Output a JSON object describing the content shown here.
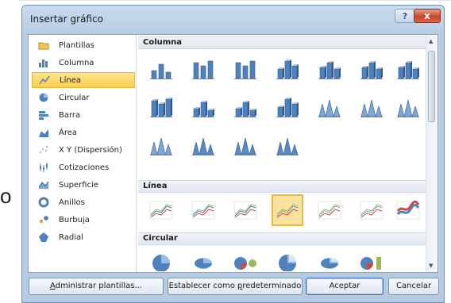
{
  "background_char": "o",
  "dialog": {
    "title": "Insertar gráfico",
    "help_label": "?",
    "close_label": "x"
  },
  "chart_types": [
    {
      "label": "Plantillas",
      "icon": "folder-icon",
      "selected": false
    },
    {
      "label": "Columna",
      "icon": "column-chart-icon",
      "selected": false
    },
    {
      "label": "Línea",
      "icon": "line-chart-icon",
      "selected": true
    },
    {
      "label": "Circular",
      "icon": "pie-chart-icon",
      "selected": false
    },
    {
      "label": "Barra",
      "icon": "bar-chart-icon",
      "selected": false
    },
    {
      "label": "Área",
      "icon": "area-chart-icon",
      "selected": false
    },
    {
      "label": "X Y (Dispersión)",
      "icon": "scatter-chart-icon",
      "selected": false
    },
    {
      "label": "Cotizaciones",
      "icon": "stock-chart-icon",
      "selected": false
    },
    {
      "label": "Superficie",
      "icon": "surface-chart-icon",
      "selected": false
    },
    {
      "label": "Anillos",
      "icon": "doughnut-chart-icon",
      "selected": false
    },
    {
      "label": "Burbuja",
      "icon": "bubble-chart-icon",
      "selected": false
    },
    {
      "label": "Radial",
      "icon": "radar-chart-icon",
      "selected": false
    }
  ],
  "gallery": {
    "sections": [
      {
        "title": "Columna"
      },
      {
        "title": "Línea"
      },
      {
        "title": "Circular"
      }
    ],
    "column_subtypes": [
      "clustered-column",
      "stacked-column",
      "100-stacked-column",
      "3d-clustered-column",
      "3d-stacked-column",
      "3d-100-stacked-column",
      "3d-column",
      "clustered-cylinder",
      "stacked-cylinder",
      "100-stacked-cylinder",
      "3d-cylinder",
      "clustered-cone",
      "stacked-cone",
      "100-stacked-cone",
      "3d-cone",
      "clustered-pyramid",
      "stacked-pyramid",
      "3d-pyramid"
    ],
    "line_subtypes": [
      "line",
      "stacked-line",
      "100-stacked-line",
      "line-with-markers",
      "stacked-line-markers",
      "100-stacked-line-markers",
      "3d-line"
    ],
    "line_selected_index": 3,
    "pie_subtypes": [
      "pie",
      "3d-pie",
      "pie-of-pie",
      "exploded-pie",
      "3d-exploded-pie",
      "bar-of-pie"
    ]
  },
  "buttons": {
    "manage_templates": {
      "pre": "",
      "key": "A",
      "post": "dministrar plantillas..."
    },
    "set_default": {
      "pre": "Establecer como ",
      "key": "p",
      "post": "redeterminado"
    },
    "ok": "Aceptar",
    "cancel": "Cancelar"
  },
  "colors": {
    "accent_selected": "#f9cd4f",
    "icon_blue": "#4f81bd",
    "frame": "#b5cbe2"
  }
}
